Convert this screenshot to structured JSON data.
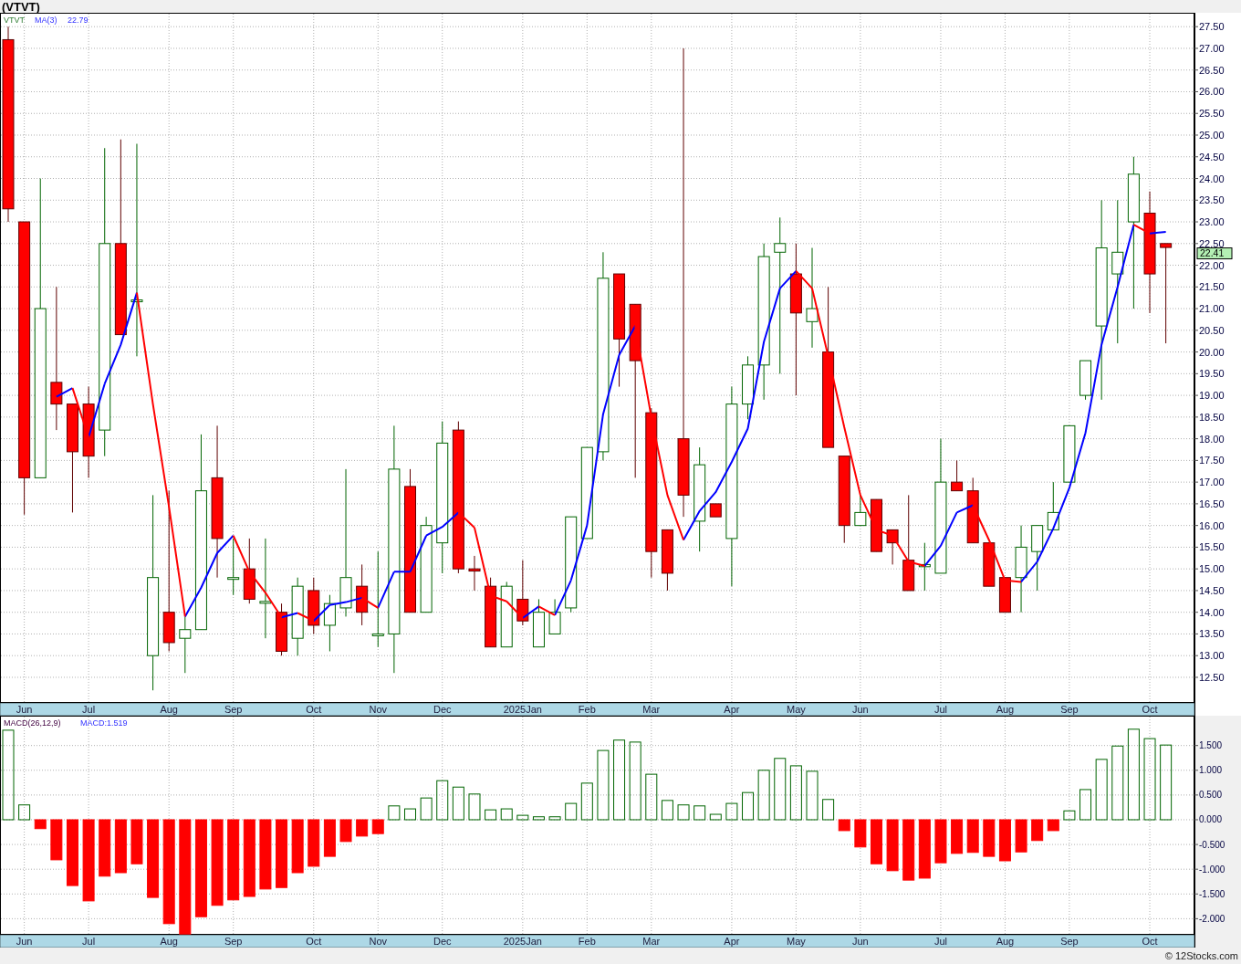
{
  "header": {
    "title": "(VTVT)"
  },
  "price_panel": {
    "legend": {
      "symbol": "VTVT",
      "indicator": "MA(3)",
      "indicator_value": "22.79"
    },
    "last_price": "22.41",
    "chart_data": {
      "type": "candlestick",
      "grid": true,
      "ylim": [
        11.91,
        27.82
      ],
      "categories": [
        null,
        "Jun",
        null,
        null,
        null,
        "Jul",
        null,
        null,
        null,
        null,
        "Aug",
        null,
        null,
        null,
        "Sep",
        null,
        null,
        null,
        null,
        "Oct",
        null,
        null,
        null,
        "Nov",
        null,
        null,
        null,
        "Dec",
        null,
        null,
        null,
        null,
        "2025Jan",
        null,
        null,
        null,
        "Feb",
        null,
        null,
        null,
        "Mar",
        null,
        null,
        null,
        null,
        "Apr",
        null,
        null,
        null,
        "May",
        null,
        null,
        null,
        "Jun",
        null,
        null,
        null,
        null,
        "Jul",
        null,
        null,
        null,
        "Aug",
        null,
        null,
        null,
        "Sep",
        null,
        null,
        null,
        null,
        "Oct",
        null
      ],
      "ohlc": [
        [
          27.2,
          27.5,
          23.0,
          23.3
        ],
        [
          23.0,
          23.0,
          16.25,
          17.1
        ],
        [
          17.1,
          24.0,
          17.1,
          21.0
        ],
        [
          19.3,
          21.5,
          18.2,
          18.8
        ],
        [
          18.8,
          18.8,
          16.3,
          17.7
        ],
        [
          18.8,
          19.2,
          17.1,
          17.6
        ],
        [
          18.2,
          24.7,
          17.6,
          22.5
        ],
        [
          22.5,
          24.9,
          20.4,
          20.4
        ],
        [
          21.2,
          24.8,
          19.9,
          21.2
        ],
        [
          13.0,
          16.7,
          12.2,
          14.8
        ],
        [
          14.0,
          16.8,
          13.1,
          13.3
        ],
        [
          13.4,
          13.9,
          12.6,
          13.6
        ],
        [
          13.6,
          18.1,
          13.6,
          16.8
        ],
        [
          17.1,
          18.3,
          14.8,
          15.7
        ],
        [
          14.8,
          15.7,
          14.4,
          14.8
        ],
        [
          15.0,
          15.7,
          14.2,
          14.3
        ],
        [
          14.25,
          15.7,
          13.4,
          14.25
        ],
        [
          14.0,
          14.2,
          13.0,
          13.1
        ],
        [
          13.4,
          14.8,
          13.0,
          14.6
        ],
        [
          14.5,
          14.8,
          13.5,
          13.7
        ],
        [
          13.7,
          14.4,
          13.1,
          14.2
        ],
        [
          14.1,
          17.3,
          13.9,
          14.8
        ],
        [
          14.6,
          15.1,
          13.7,
          14.0
        ],
        [
          13.5,
          15.4,
          13.2,
          13.5
        ],
        [
          13.5,
          18.3,
          12.6,
          17.3
        ],
        [
          16.9,
          17.3,
          14.0,
          14.0
        ],
        [
          14.0,
          16.2,
          14.0,
          16.0
        ],
        [
          15.6,
          18.4,
          14.9,
          17.9
        ],
        [
          18.2,
          18.4,
          14.9,
          15.0
        ],
        [
          15.0,
          15.3,
          14.5,
          14.95
        ],
        [
          14.6,
          14.8,
          13.2,
          13.2
        ],
        [
          13.2,
          14.7,
          13.2,
          14.6
        ],
        [
          14.3,
          15.2,
          13.7,
          13.8
        ],
        [
          13.2,
          14.3,
          13.2,
          14.0
        ],
        [
          13.5,
          14.3,
          13.5,
          14.0
        ],
        [
          14.1,
          16.2,
          14.0,
          16.2
        ],
        [
          15.7,
          17.8,
          15.7,
          17.8
        ],
        [
          17.7,
          22.3,
          17.5,
          21.7
        ],
        [
          21.8,
          21.8,
          19.2,
          20.3
        ],
        [
          21.1,
          21.1,
          17.1,
          19.8
        ],
        [
          18.6,
          18.7,
          14.8,
          15.4
        ],
        [
          15.9,
          15.9,
          14.5,
          14.9
        ],
        [
          18.0,
          27.0,
          16.2,
          16.7
        ],
        [
          16.1,
          17.8,
          15.4,
          17.4
        ],
        [
          16.5,
          16.5,
          16.2,
          16.2
        ],
        [
          15.7,
          19.2,
          14.6,
          18.8
        ],
        [
          18.8,
          19.9,
          18.45,
          19.7
        ],
        [
          19.7,
          22.5,
          18.9,
          22.2
        ],
        [
          22.3,
          23.1,
          19.5,
          22.5
        ],
        [
          21.8,
          22.5,
          19.0,
          20.9
        ],
        [
          20.7,
          22.4,
          20.1,
          21.0
        ],
        [
          20.0,
          21.5,
          17.8,
          17.8
        ],
        [
          17.6,
          17.6,
          15.6,
          16.0
        ],
        [
          16.0,
          16.7,
          16.0,
          16.3
        ],
        [
          16.6,
          16.6,
          15.4,
          15.4
        ],
        [
          15.9,
          15.9,
          15.1,
          15.6
        ],
        [
          15.2,
          16.7,
          14.5,
          14.5
        ],
        [
          15.05,
          15.6,
          14.5,
          15.1
        ],
        [
          14.9,
          18.0,
          14.9,
          17.0
        ],
        [
          17.0,
          17.5,
          16.8,
          16.8
        ],
        [
          16.8,
          17.1,
          15.6,
          15.6
        ],
        [
          15.6,
          15.6,
          14.6,
          14.6
        ],
        [
          14.8,
          14.8,
          14.0,
          14.0
        ],
        [
          14.8,
          16.0,
          14.0,
          15.5
        ],
        [
          15.4,
          16.0,
          14.5,
          16.0
        ],
        [
          15.9,
          17.0,
          15.9,
          16.3
        ],
        [
          17.0,
          18.3,
          17.0,
          18.3
        ],
        [
          19.0,
          19.8,
          18.9,
          19.8
        ],
        [
          20.6,
          23.5,
          18.9,
          22.4
        ],
        [
          21.8,
          23.5,
          20.2,
          22.3
        ],
        [
          23.0,
          24.5,
          21.0,
          24.1
        ],
        [
          23.2,
          23.7,
          20.9,
          21.8
        ],
        [
          22.5,
          22.5,
          20.2,
          22.41
        ]
      ],
      "yticks": [
        {
          "value": 27.5,
          "label": "27.50"
        },
        {
          "value": 27,
          "label": "27.00"
        },
        {
          "value": 26.5,
          "label": "26.50"
        },
        {
          "value": 26,
          "label": "26.00"
        },
        {
          "value": 25.5,
          "label": "25.50"
        },
        {
          "value": 25,
          "label": "25.00"
        },
        {
          "value": 24.5,
          "label": "24.50"
        },
        {
          "value": 24,
          "label": "24.00"
        },
        {
          "value": 23.5,
          "label": "23.50"
        },
        {
          "value": 23,
          "label": "23.00"
        },
        {
          "value": 22.5,
          "label": "22.50"
        },
        {
          "value": 22,
          "label": "22.00"
        },
        {
          "value": 21.5,
          "label": "21.50"
        },
        {
          "value": 21,
          "label": "21.00"
        },
        {
          "value": 20.5,
          "label": "20.50"
        },
        {
          "value": 20,
          "label": "20.00"
        },
        {
          "value": 19.5,
          "label": "19.50"
        },
        {
          "value": 19,
          "label": "19.00"
        },
        {
          "value": 18.5,
          "label": "18.50"
        },
        {
          "value": 18,
          "label": "18.00"
        },
        {
          "value": 17.5,
          "label": "17.50"
        },
        {
          "value": 17,
          "label": "17.00"
        },
        {
          "value": 16.5,
          "label": "16.50"
        },
        {
          "value": 16,
          "label": "16.00"
        },
        {
          "value": 15.5,
          "label": "15.50"
        },
        {
          "value": 15,
          "label": "15.00"
        },
        {
          "value": 14.5,
          "label": "14.50"
        },
        {
          "value": 14,
          "label": "14.00"
        },
        {
          "value": 13.5,
          "label": "13.50"
        },
        {
          "value": 13,
          "label": "13.00"
        },
        {
          "value": 12.5,
          "label": "12.50"
        }
      ]
    }
  },
  "macd_panel": {
    "legend": {
      "indicator": "MACD(26,12,9)",
      "reading": "MACD:1.519"
    },
    "chart_data": {
      "type": "bar",
      "grid": true,
      "ylim": [
        -2.325,
        2.103
      ],
      "categories": [
        null,
        "Jun",
        null,
        null,
        null,
        "Jul",
        null,
        null,
        null,
        null,
        "Aug",
        null,
        null,
        null,
        "Sep",
        null,
        null,
        null,
        null,
        "Oct",
        null,
        null,
        null,
        "Nov",
        null,
        null,
        null,
        "Dec",
        null,
        null,
        null,
        null,
        "2025Jan",
        null,
        null,
        null,
        "Feb",
        null,
        null,
        null,
        "Mar",
        null,
        null,
        null,
        null,
        "Apr",
        null,
        null,
        null,
        "May",
        null,
        null,
        null,
        "Jun",
        null,
        null,
        null,
        null,
        "Jul",
        null,
        null,
        null,
        "Aug",
        null,
        null,
        null,
        "Sep",
        null,
        null,
        null,
        null,
        "Oct",
        null
      ],
      "yticks": [
        {
          "value": 1.5,
          "label": "1.500"
        },
        {
          "value": 1,
          "label": "1.000"
        },
        {
          "value": 0.5,
          "label": "0.500"
        },
        {
          "value": 0,
          "label": "0.000"
        },
        {
          "value": -0.5,
          "label": "-0.500"
        },
        {
          "value": -1,
          "label": "-1.000"
        },
        {
          "value": -1.5,
          "label": "-1.500"
        },
        {
          "value": -2,
          "label": "-2.000"
        }
      ],
      "values": [
        1.81,
        0.3,
        -0.18,
        -0.81,
        -1.33,
        -1.64,
        -1.14,
        -1.07,
        -0.89,
        -1.57,
        -2.1,
        -2.32,
        -1.96,
        -1.73,
        -1.62,
        -1.55,
        -1.4,
        -1.37,
        -1.07,
        -0.94,
        -0.74,
        -0.44,
        -0.33,
        -0.28,
        0.28,
        0.22,
        0.44,
        0.79,
        0.66,
        0.52,
        0.2,
        0.22,
        0.09,
        0.06,
        0.06,
        0.33,
        0.74,
        1.4,
        1.61,
        1.57,
        0.92,
        0.39,
        0.3,
        0.28,
        0.11,
        0.33,
        0.55,
        1.0,
        1.24,
        1.09,
        0.98,
        0.41,
        -0.22,
        -0.55,
        -0.89,
        -1.03,
        -1.22,
        -1.18,
        -0.87,
        -0.68,
        -0.66,
        -0.74,
        -0.83,
        -0.65,
        -0.42,
        -0.22,
        0.18,
        0.61,
        1.22,
        1.49,
        1.83,
        1.64,
        1.51
      ]
    }
  },
  "footer": {
    "copyright": "© 12Stocks.com"
  }
}
